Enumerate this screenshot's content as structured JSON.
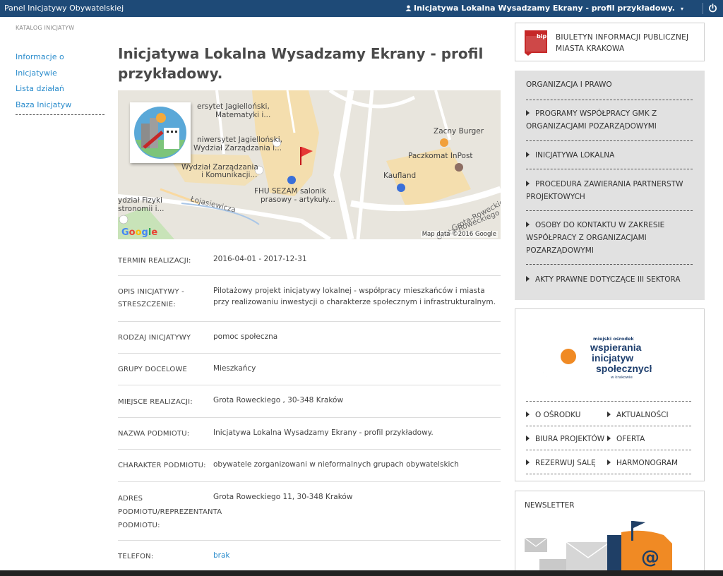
{
  "topbar": {
    "brand": "Panel Inicjatywy Obywatelskiej",
    "user": "Inicjatywa Lokalna Wysadzamy Ekrany - profil przykładowy.",
    "caret": "▾"
  },
  "breadcrumb": "KATALOG INICJATYW",
  "leftnav": {
    "items": [
      "Informacje o Inicjatywie",
      "Lista działań",
      "Baza Inicjatyw"
    ]
  },
  "page": {
    "title": "Inicjatywa Lokalna Wysadzamy Ekrany - profil przykładowy."
  },
  "map": {
    "labels": {
      "uni1": "ersytet Jagielloński,",
      "uni1b": "Matematyki i...",
      "uni2": "niwersytet Jagielloński,",
      "uni2b": "Wydział Zarządzania i...",
      "wz": "Wydział Zarządzania",
      "wzb": "i Komunikacji...",
      "fhu": "FHU SEZAM salonik",
      "fhub": "prasowy - artykuły...",
      "fiz": "ydział Fizyki",
      "fizb": "stronomii i...",
      "loj": "Łojasiewicza",
      "zacny": "Zacny Burger",
      "paczkomat": "Paczkomat InPost",
      "kaufland": "Kaufland",
      "grota": "Grota-Roweckiego",
      "grota2": "Grota-Roweckiego"
    },
    "google": "Google",
    "mapdata": "Map data ©2016 Google"
  },
  "details": {
    "termin_label": "TERMIN REALIZACJI:",
    "termin_value": "2016-04-01 - 2017-12-31",
    "opis_label": "OPIS INICJATYWY - STRESZCZENIE:",
    "opis_value": "Pilotażowy projekt inicjatywy lokalnej - współpracy mieszkańców i miasta przy realizowaniu inwestycji o charakterze społecznym i infrastrukturalnym.",
    "rodzaj_label": "RODZAJ INICJATYWY",
    "rodzaj_value": "pomoc społeczna",
    "grupy_label": "GRUPY DOCELOWE",
    "grupy_value": "Mieszkańcy",
    "miejsce_label": "MIEJSCE REALIZACJI:",
    "miejsce_value": "Grota Roweckiego , 30-348 Kraków",
    "nazwa_label": "NAZWA PODMIOTU:",
    "nazwa_value": "Inicjatywa Lokalna Wysadzamy Ekrany - profil przykładowy.",
    "charakter_label": "CHARAKTER PODMIOTU:",
    "charakter_value": "obywatele zorganizowani w nieformalnych grupach obywatelskich",
    "adres_label": "ADRES PODMIOTU/REPREZENTANTA PODMIOTU:",
    "adres_value": "Grota Roweckiego 11, 30-348 Kraków",
    "telefon_label": "TELEFON:",
    "telefon_value": "brak"
  },
  "bip": {
    "icon_text": "bip",
    "line1": "BIULETYN INFORMACJI PUBLICZNEJ",
    "line2": "MIASTA KRAKOWA"
  },
  "org": {
    "head": "ORGANIZACJA I PRAWO",
    "items": [
      "PROGRAMY WSPÓŁPRACY GMK Z ORGANIZACJAMI POZARZĄDOWYMI",
      "INICJATYWA LOKALNA",
      "PROCEDURA ZAWIERANIA PARTNERSTW PROJEKTOWYCH",
      "OSOBY DO KONTAKTU W ZAKRESIE WSPÓŁPRACY Z ORGANIZACJAMI POZARZĄDOWYMI",
      "AKTY PRAWNE DOTYCZĄCE III SEKTORA"
    ]
  },
  "mowis": {
    "logo_small": "miejski ośrodek",
    "logo_l1": "wspierania",
    "logo_l2": "inicjatyw",
    "logo_l3": "społecznych",
    "logo_city": "w krakowie",
    "links": [
      "O OŚRODKU",
      "AKTUALNOŚCI",
      "BIURA PROJEKTÓW",
      "OFERTA",
      "REZERWUJ SALĘ",
      "HARMONOGRAM"
    ]
  },
  "newsletter": {
    "head": "NEWSLETTER",
    "at": "@"
  }
}
